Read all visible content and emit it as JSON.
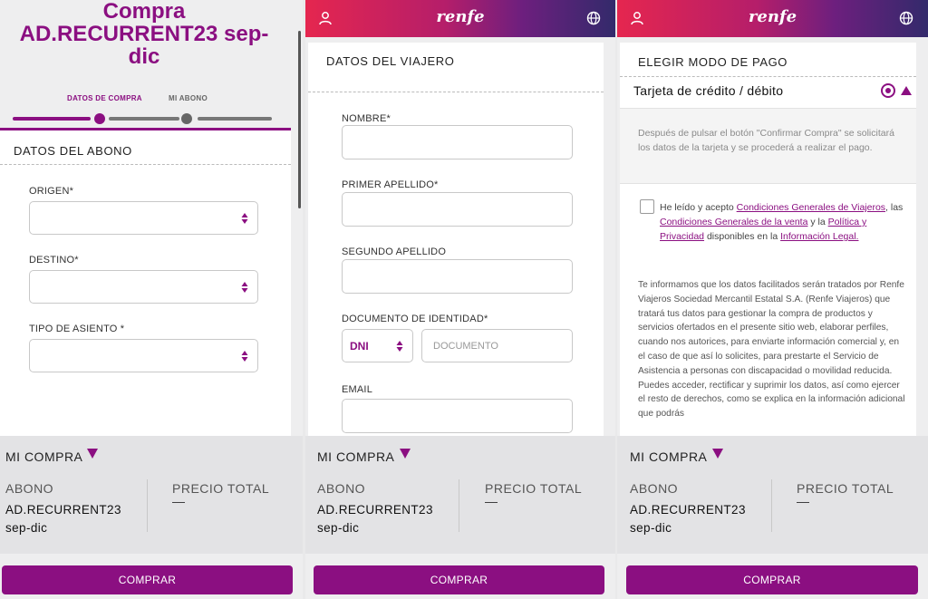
{
  "colors": {
    "brand": "#8b0f81",
    "header_start": "#e5264f",
    "header_end": "#332a6b"
  },
  "panel1": {
    "title_line1": "Compra",
    "title_line2": "AD.RECURRENT23 sep-dic",
    "steps": [
      "DATOS DE COMPRA",
      "MI ABONO"
    ],
    "section_title": "DATOS DEL ABONO",
    "fields": [
      "ORIGEN*",
      "DESTINO*",
      "TIPO DE ASIENTO *"
    ]
  },
  "header": {
    "logo": "renfe",
    "icons": [
      "user-icon",
      "globe-icon"
    ]
  },
  "panel2": {
    "section_title": "DATOS DEL VIAJERO",
    "fields": [
      "NOMBRE*",
      "PRIMER APELLIDO*",
      "SEGUNDO APELLIDO",
      "DOCUMENTO DE IDENTIDAD*",
      "EMAIL"
    ],
    "doc_type": "DNI",
    "doc_placeholder": "DOCUMENTO"
  },
  "panel3": {
    "section_title": "ELEGIR MODO DE PAGO",
    "payment_option": "Tarjeta de crédito / débito",
    "payment_selected": true,
    "info": "Después de pulsar el botón \"Confirmar Compra\" se solicitará los datos de la tarjeta y se procederá a realizar el pago.",
    "legal": {
      "t1": "He leído y acepto ",
      "link1": "Condiciones Generales de Viajeros",
      "t2": ", las ",
      "link2": "Condiciones Generales de la venta",
      "t3": " y la ",
      "link3": "Política y Privacidad",
      "t4": " disponibles en la ",
      "link4": "Información Legal."
    },
    "privacy": "Te informamos que los datos facilitados serán tratados por Renfe Viajeros Sociedad Mercantil Estatal S.A. (Renfe Viajeros) que tratará tus datos para gestionar la compra de productos y servicios ofertados en el presente sitio web, elaborar perfiles, cuando nos autorices, para enviarte información comercial y, en el caso de que así lo solicites, para prestarte el Servicio de Asistencia a personas con discapacidad o movilidad reducida. Puedes acceder, rectificar y suprimir los datos, así como ejercer el resto de derechos, como se explica en la información adicional que podrás"
  },
  "summary": {
    "heading": "MI COMPRA",
    "pass_label": "ABONO",
    "pass_value": "AD.RECURRENT23 sep-dic",
    "price_label": "PRECIO TOTAL",
    "price_value": "—"
  },
  "buy_button": "COMPRAR"
}
